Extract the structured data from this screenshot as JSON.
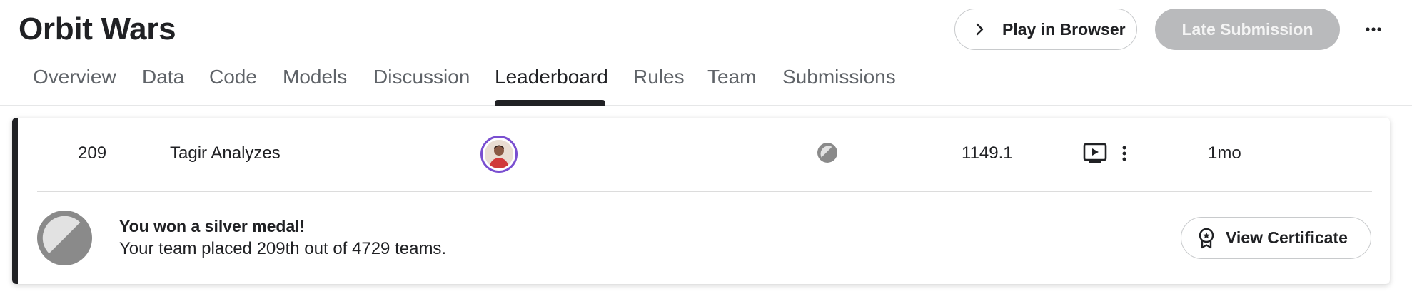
{
  "header": {
    "title": "Orbit Wars",
    "play_label": "Play in Browser",
    "late_label": "Late Submission",
    "more_icon": "more-horizontal-icon"
  },
  "tabs": [
    {
      "label": "Overview"
    },
    {
      "label": "Data"
    },
    {
      "label": "Code"
    },
    {
      "label": "Models"
    },
    {
      "label": "Discussion"
    },
    {
      "label": "Leaderboard",
      "active": true
    },
    {
      "label": "Rules"
    },
    {
      "label": "Team"
    },
    {
      "label": "Submissions"
    }
  ],
  "row": {
    "rank": "209",
    "team_name": "Tagir Analyzes",
    "medal": "silver",
    "score": "1149.1",
    "last": "1mo"
  },
  "medal_banner": {
    "title": "You won a silver medal!",
    "subtitle": "Your team placed 209th out of 4729 teams.",
    "cert_label": "View Certificate"
  },
  "colors": {
    "text": "#202124",
    "muted": "#5f6368",
    "silver": "#8a8a8a",
    "avatar_ring": "#7a4fd0",
    "disabled_btn": "#b9babc"
  }
}
